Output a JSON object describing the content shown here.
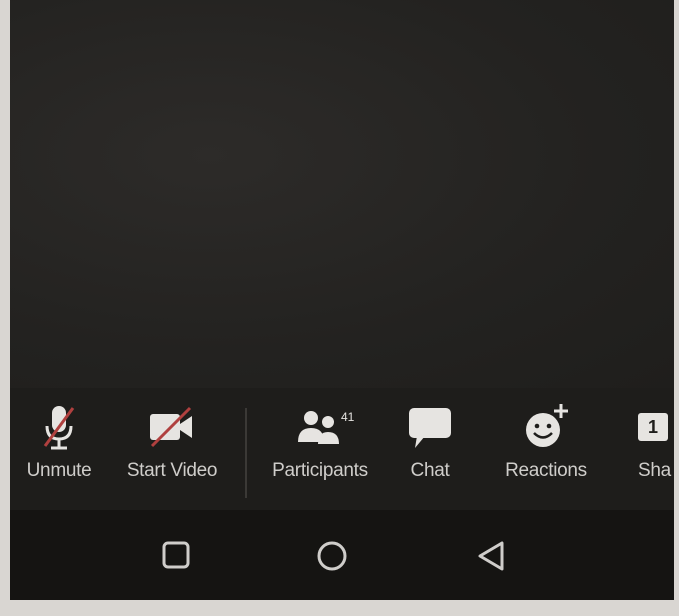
{
  "toolbar": {
    "items": [
      {
        "label": "Unmute",
        "icon": "microphone-muted-icon"
      },
      {
        "label": "Start Video",
        "icon": "video-camera-off-icon"
      },
      {
        "label": "Participants",
        "icon": "participants-icon",
        "count": "41"
      },
      {
        "label": "Chat",
        "icon": "chat-bubble-icon"
      },
      {
        "label": "Reactions",
        "icon": "reactions-smiley-icon"
      },
      {
        "label": "Sha",
        "icon": "share-icon",
        "icon_text": "1"
      }
    ]
  },
  "navbar": {
    "buttons": [
      "recents-square-icon",
      "home-circle-icon",
      "back-triangle-icon"
    ]
  },
  "colors": {
    "background": "#252422",
    "toolbar": "#1e1d1b",
    "muted_slash": "#b0403f",
    "icon": "#e6e4e1"
  }
}
